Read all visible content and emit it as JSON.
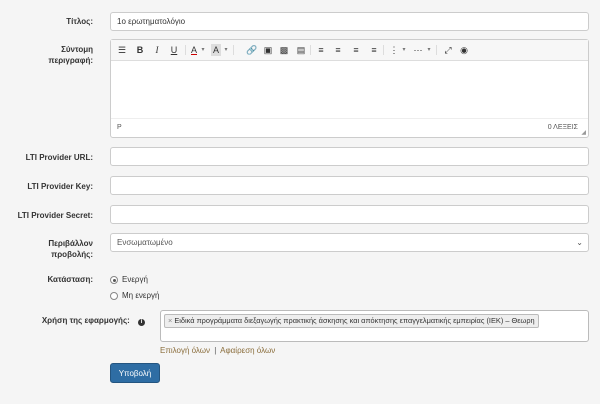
{
  "form": {
    "title_label": "Τίτλος:",
    "title_value": "1ο ερωτηματολόγιο",
    "desc_label": "Σύντομη περιγραφή:",
    "editor": {
      "status_path": "P",
      "word_count": "0 ΛΕΞΕΙΣ"
    },
    "lti_url_label": "LTI Provider URL:",
    "lti_key_label": "LTI Provider Key:",
    "lti_secret_label": "LTI Provider Secret:",
    "env_label": "Περιβάλλον προβολής:",
    "env_value": "Ενσωματωμένο",
    "status_label": "Κατάσταση:",
    "status_options": [
      "Ενεργή",
      "Μη ενεργή"
    ],
    "usage_label": "Χρήση της εφαρμογής:",
    "usage_tag": "Ειδικά προγράμματα διεξαγωγής πρακτικής άσκησης και απόκτησης επαγγελματικής εμπειρίας (ΙΕΚ) – Θεωρη",
    "select_all": "Επιλογή όλων",
    "separator": "|",
    "remove_all": "Αφαίρεση όλων",
    "submit_label": "Υποβολή"
  },
  "colors": {
    "primary": "#2e6da4",
    "link": "#8a6d3b"
  }
}
